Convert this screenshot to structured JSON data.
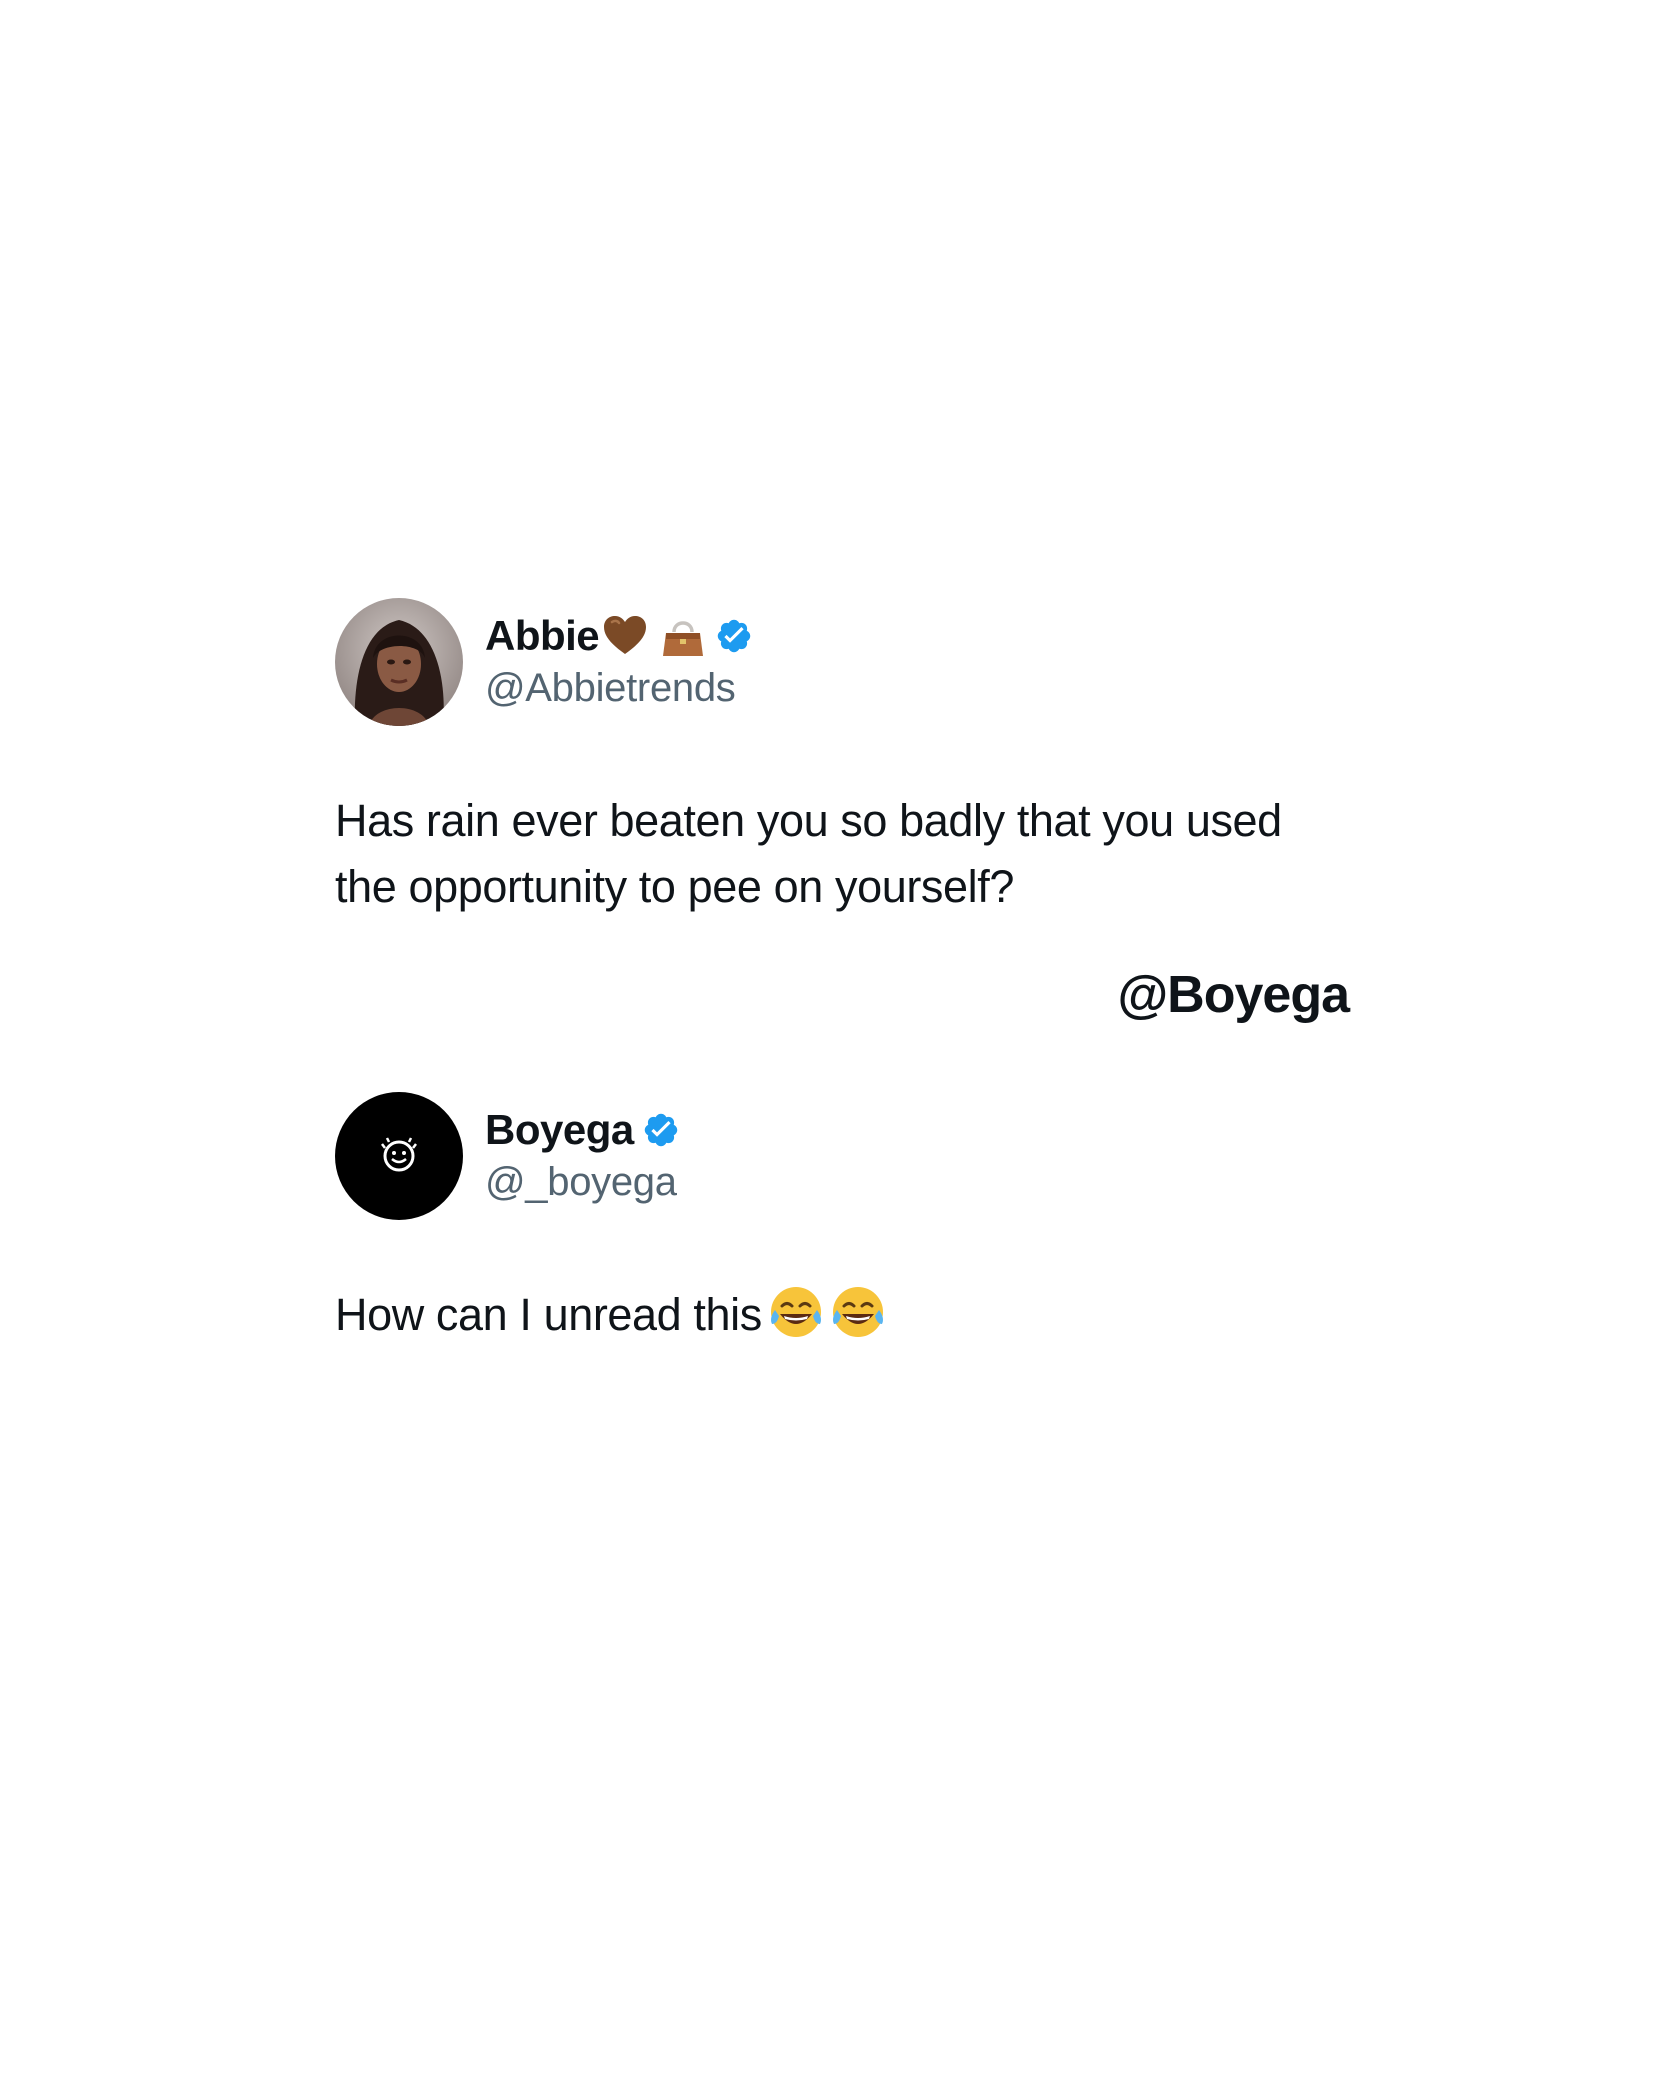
{
  "tweets": [
    {
      "display_name": "Abbie",
      "name_emojis": [
        "brown-heart-icon",
        "handbag-icon"
      ],
      "verified": true,
      "handle": "@Abbietrends",
      "text_line1": "Has rain ever beaten you so badly that you used",
      "text_line2": "the opportunity to pee on yourself?"
    },
    {
      "display_name": "Boyega",
      "verified": true,
      "handle": "@_boyega",
      "text": "How can I unread this",
      "text_emojis": [
        "face-with-tears-of-joy-icon",
        "face-with-tears-of-joy-icon"
      ]
    }
  ],
  "watermark": "@Boyega",
  "colors": {
    "verified_blue": "#1d9bf0",
    "handle_gray": "#536471",
    "text": "#0f1419"
  }
}
